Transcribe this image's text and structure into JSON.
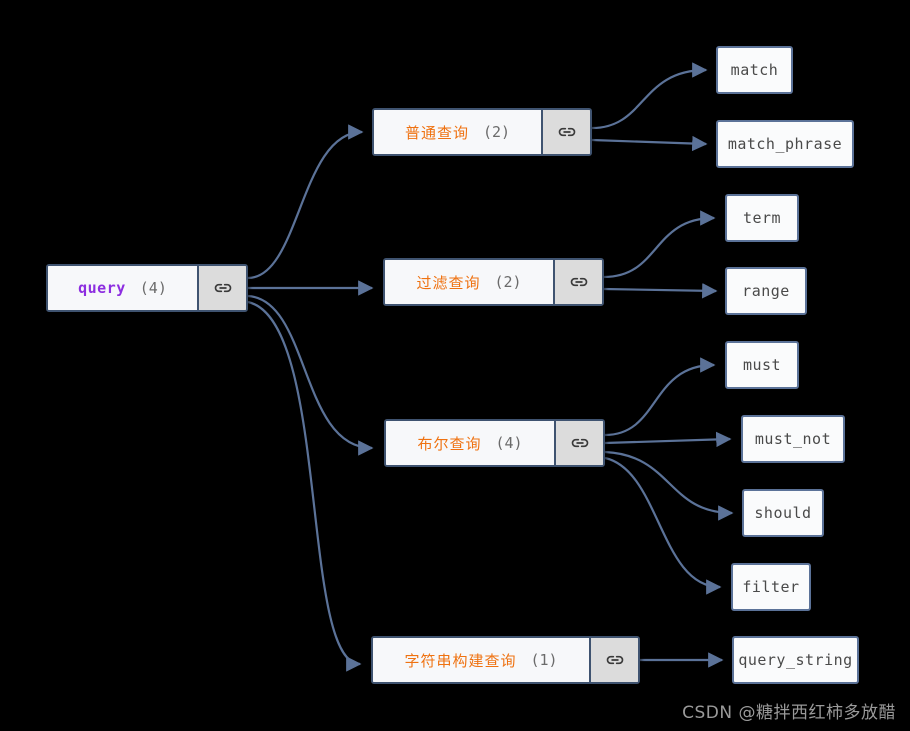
{
  "diagram": {
    "background_color": "#000000",
    "edge_color": "#5b7298",
    "root": {
      "label": "query",
      "count": "(4)",
      "label_color": "#8d2ee0",
      "icon": "link-icon"
    },
    "branches": [
      {
        "label": "普通查询",
        "count": "(2)",
        "label_color": "#ef7211",
        "icon": "link-icon",
        "children": [
          "match",
          "match_phrase"
        ]
      },
      {
        "label": "过滤查询",
        "count": "(2)",
        "label_color": "#ef7211",
        "icon": "link-icon",
        "children": [
          "term",
          "range"
        ]
      },
      {
        "label": "布尔查询",
        "count": "(4)",
        "label_color": "#ef7211",
        "icon": "link-icon",
        "children": [
          "must",
          "must_not",
          "should",
          "filter"
        ]
      },
      {
        "label": "字符串构建查询",
        "count": "(1)",
        "label_color": "#ef7211",
        "icon": "link-icon",
        "children": [
          "query_string"
        ]
      }
    ],
    "leaves": {
      "match": "match",
      "match_phrase": "match_phrase",
      "term": "term",
      "range": "range",
      "must": "must",
      "must_not": "must_not",
      "should": "should",
      "filter": "filter",
      "query_string": "query_string"
    }
  },
  "watermark": {
    "text": "CSDN @糖拌西红柿多放醋"
  }
}
